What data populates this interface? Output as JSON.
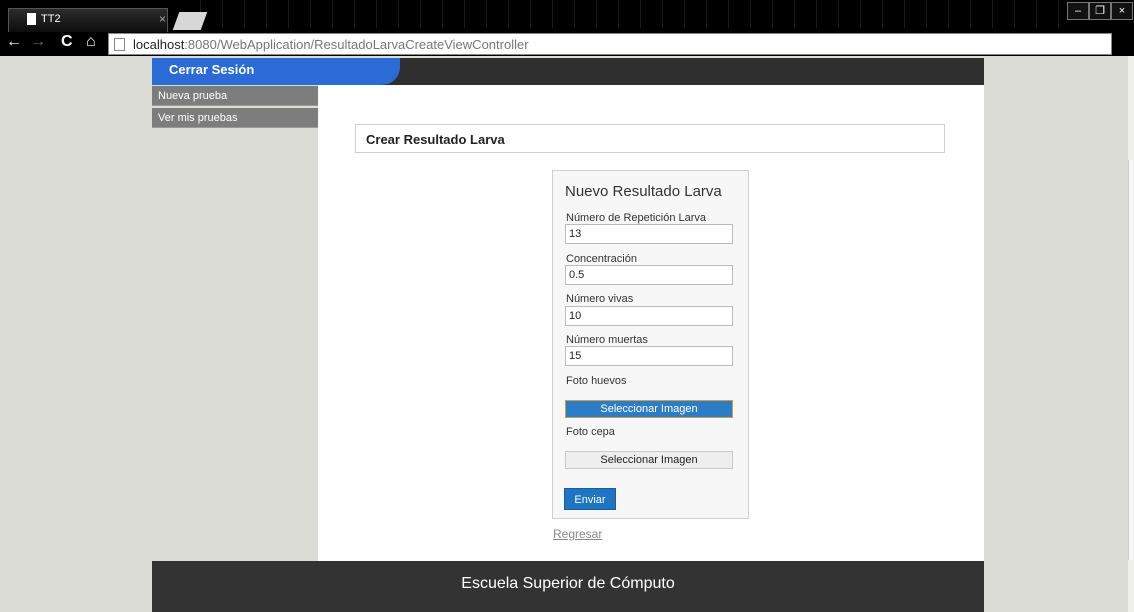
{
  "browser": {
    "tab_title": "TT2",
    "tab_close": "×",
    "nav": {
      "back": "←",
      "forward": "→",
      "reload": "C",
      "home": "⌂"
    },
    "url_host": "localhost",
    "url_rest": ":8080/WebApplication/ResultadoLarvaCreateViewController",
    "window_controls": {
      "minimize": "–",
      "restore": "❐",
      "close": "×"
    },
    "star": "☆",
    "menu": "≡"
  },
  "header": {
    "logout_label": "Cerrar Sesión"
  },
  "sidebar": {
    "items": [
      {
        "label": "Nueva prueba"
      },
      {
        "label": "Ver mis pruebas"
      }
    ]
  },
  "main": {
    "panel_title": "Crear Resultado Larva",
    "form": {
      "title": "Nuevo Resultado Larva",
      "fields": [
        {
          "label": "Número de Repetición Larva",
          "value": "13"
        },
        {
          "label": "Concentración",
          "value": "0.5"
        },
        {
          "label": "Número vivas",
          "value": "10"
        },
        {
          "label": "Número muertas",
          "value": "15"
        }
      ],
      "photo_eggs_label": "Foto huevos",
      "photo_eggs_button": "Seleccionar Imagen",
      "photo_strain_label": "Foto cepa",
      "photo_strain_button": "Seleccionar Imagen",
      "submit_label": "Enviar"
    },
    "back_link": "Regresar"
  },
  "footer": {
    "text": "Escuela Superior de Cómputo"
  }
}
